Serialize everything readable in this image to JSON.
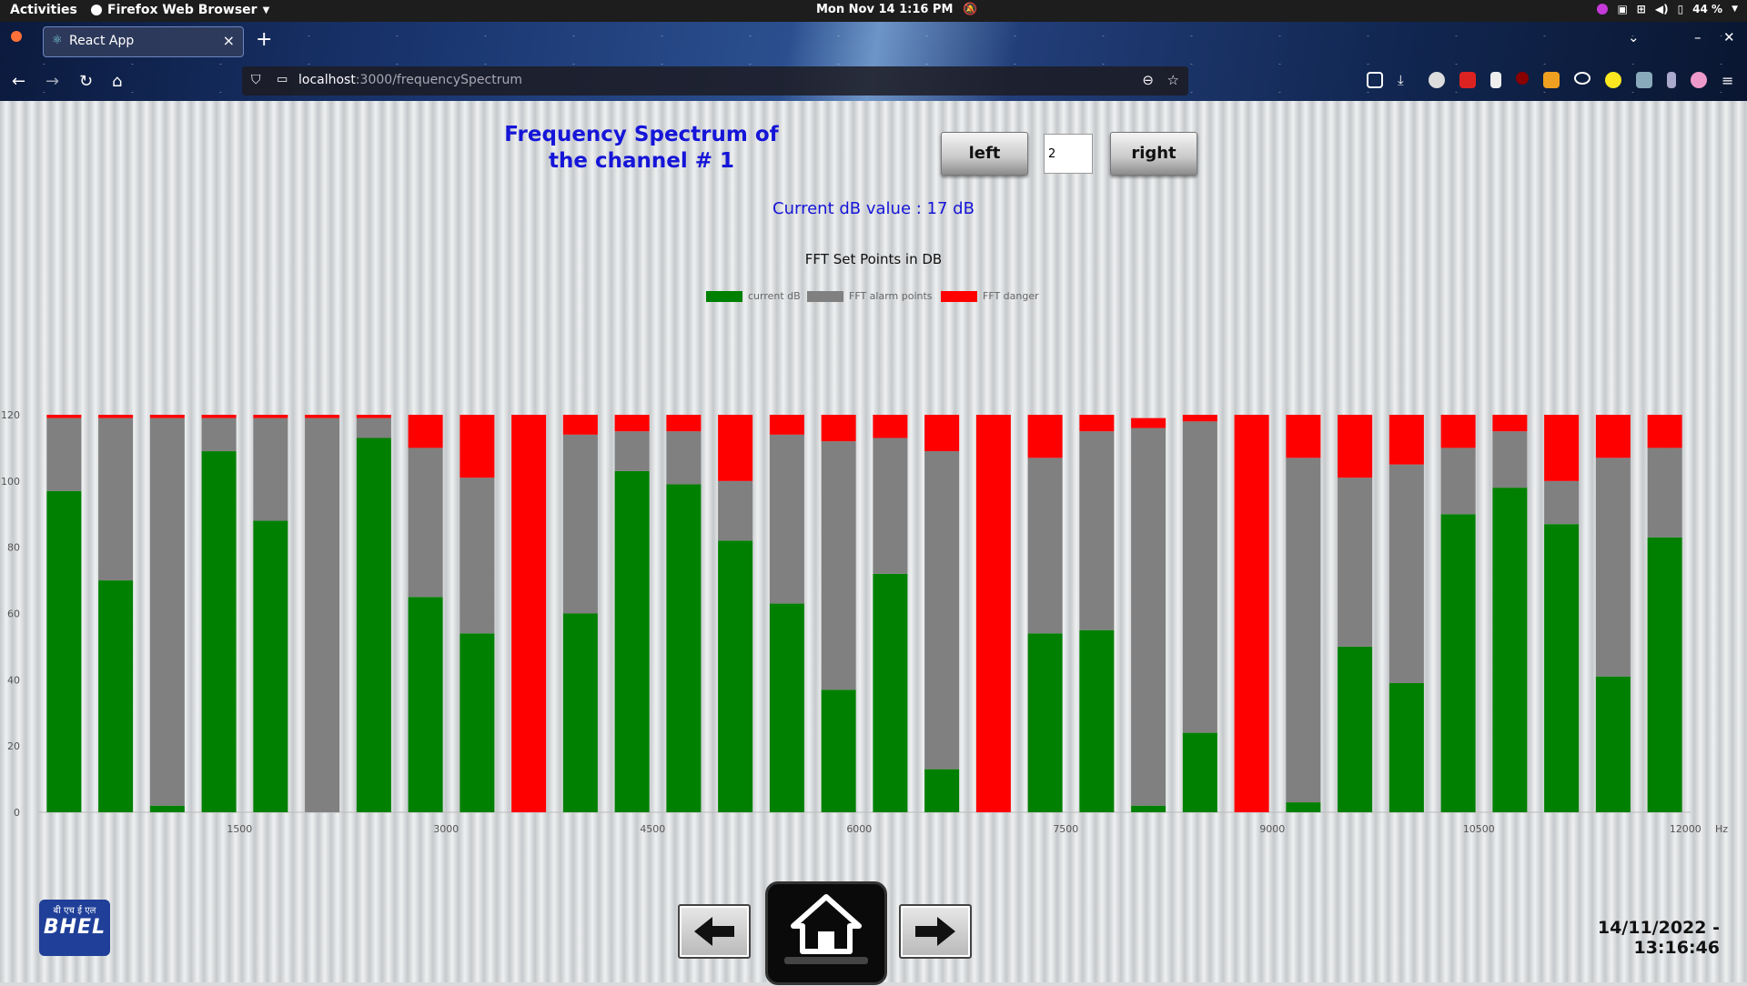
{
  "system_bar": {
    "activities": "Activities",
    "app_name": "Firefox Web Browser",
    "clock": "Mon Nov 14  1:16 PM",
    "battery": "44 %"
  },
  "browser": {
    "tab_title": "React App",
    "url_host": "localhost",
    "url_path": ":3000/frequencySpectrum"
  },
  "page": {
    "title": "Frequency Spectrum of the channel # 1",
    "left_button": "left",
    "right_button": "right",
    "channel_input": "2",
    "current_db": "Current dB value : 17 dB",
    "datetime": "14/11/2022 - 13:16:46",
    "logo_top": "बी एच ई एल",
    "logo_main": "BHEL"
  },
  "chart_data": {
    "type": "bar",
    "title": "FFT Set Points in DB",
    "x_unit": "Hz",
    "x_ticks": [
      "1500",
      "3000",
      "4500",
      "6000",
      "7500",
      "9000",
      "10500",
      "12000"
    ],
    "y_ticks": [
      "0",
      "20",
      "40",
      "60",
      "80",
      "100",
      "120"
    ],
    "ylim": [
      0,
      120
    ],
    "stacked": true,
    "legend": [
      "current dB",
      "FFT alarm points",
      "FFT danger"
    ],
    "colors": {
      "current": "#008000",
      "alarm": "#808080",
      "danger": "#ff0000"
    },
    "series": [
      {
        "name": "current dB",
        "values": [
          97,
          70,
          2,
          109,
          88,
          0,
          113,
          65,
          54,
          0,
          60,
          103,
          99,
          82,
          63,
          37,
          72,
          13,
          0,
          54,
          55,
          2,
          24,
          0,
          3,
          50,
          39,
          90,
          98,
          87,
          41,
          83
        ]
      },
      {
        "name": "FFT alarm points",
        "values": [
          22,
          49,
          117,
          10,
          31,
          119,
          6,
          45,
          47,
          0,
          54,
          12,
          16,
          18,
          51,
          75,
          41,
          96,
          0,
          53,
          60,
          114,
          94,
          0,
          104,
          51,
          66,
          20,
          17,
          13,
          66,
          27
        ]
      },
      {
        "name": "FFT danger",
        "values": [
          1,
          1,
          1,
          1,
          1,
          1,
          1,
          10,
          19,
          120,
          6,
          5,
          5,
          20,
          6,
          8,
          7,
          11,
          120,
          13,
          5,
          3,
          2,
          120,
          13,
          19,
          15,
          10,
          5,
          20,
          13,
          10
        ]
      }
    ]
  }
}
